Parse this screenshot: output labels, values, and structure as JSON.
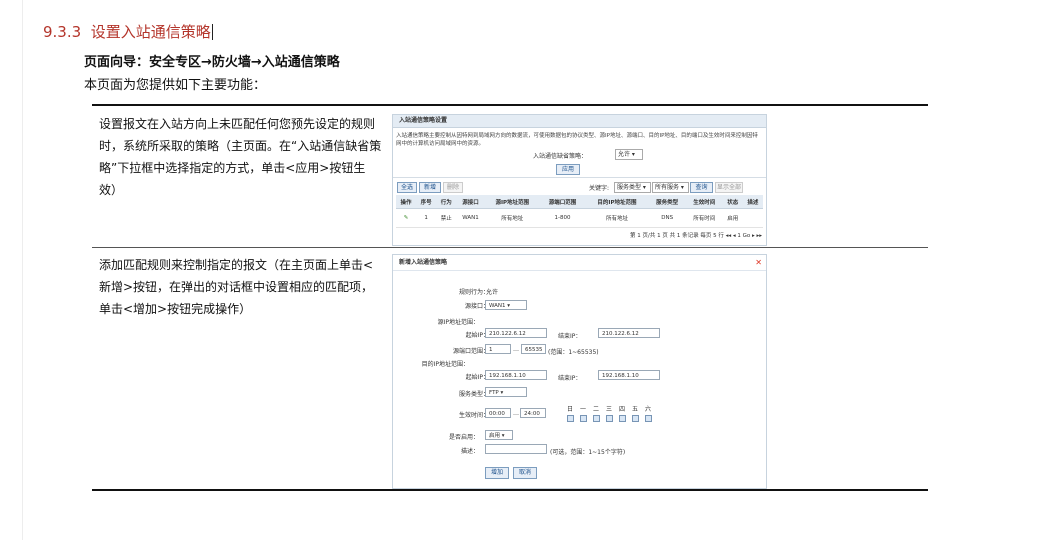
{
  "heading": {
    "number": "9.3.3",
    "title": "设置入站通信策略"
  },
  "guide": "页面向导：安全专区→防火墙→入站通信策略",
  "intro": "本页面为您提供如下主要功能：",
  "rows": [
    {
      "text": "设置报文在入站方向上未匹配任何您预先设定的规则时，系统所采取的策略（主页面。在“入站通信缺省策略”下拉框中选择指定的方式，单击<应用>按钮生效）"
    },
    {
      "text": "添加匹配规则来控制指定的报文（在主页面上单击<新增>按钮，在弹出的对话框中设置相应的匹配项，单击<增加>按钮完成操作）"
    }
  ],
  "screen1": {
    "panel_title": "入站通信策略设置",
    "note": "入站通信策略主要控制从因特网到局域网方向的数据流，可使用数据包的协议类型、源IP地址、源端口、目的IP地址、目的端口及生效时间来控制因特网中的计算机访问局域网中的资源。",
    "default_label": "入站通信缺省策略：",
    "default_value": "允许",
    "apply": "应用",
    "buttons": {
      "select_all": "全选",
      "add": "新增",
      "delete": "删除"
    },
    "keyword_label": "关键字:",
    "keyword_value": "服务类型",
    "filter_value": "所有服务",
    "query": "查询",
    "show_all": "显示全部",
    "columns": [
      "操作",
      "序号",
      "行为",
      "源接口",
      "源IP地址范围",
      "源端口范围",
      "目的IP地址范围",
      "服务类型",
      "生效时间",
      "状态",
      "描述"
    ],
    "row": {
      "index": "1",
      "action": "禁止",
      "iface": "WAN1",
      "src_ip": "所有地址",
      "src_port": "1-800",
      "dst_ip": "所有地址",
      "service": "DNS",
      "time": "所有时间",
      "status": "启用",
      "desc": ""
    },
    "pager": "第 1 页/共 1 页 共 1 条记录 每页 5 行 ◂◂ ◂ 1 Go ▸ ▸▸"
  },
  "screen2": {
    "title": "新增入站通信策略",
    "close": "✕",
    "rule_action_label": "规则行为：",
    "rule_action_value": "允许",
    "src_iface_label": "源接口：",
    "src_iface_value": "WAN1",
    "src_ip_range_label": "源IP地址范围：",
    "start_ip_label": "起始IP：",
    "src_start_ip": "210.122.6.12",
    "end_ip_label": "结束IP：",
    "src_end_ip": "210.122.6.12",
    "src_port_label": "源端口范围：",
    "src_port_start": "1",
    "src_port_end": "65535",
    "src_port_hint": "(范围：1~65535)",
    "dst_ip_range_label": "目的IP地址范围：",
    "dst_start_ip": "192.168.1.10",
    "dst_end_ip": "192.168.1.10",
    "service_label": "服务类型：",
    "service_value": "FTP",
    "time_label": "生效时间：",
    "time_start": "00:00",
    "time_end": "24:00",
    "days": [
      "日",
      "一",
      "二",
      "三",
      "四",
      "五",
      "六"
    ],
    "enabled_label": "是否启用：",
    "enabled_value": "启用",
    "desc_label": "描述：",
    "desc_hint": "(可选，范围：1~15个字符)",
    "add": "增加",
    "cancel": "取消",
    "range_sep": "…"
  }
}
